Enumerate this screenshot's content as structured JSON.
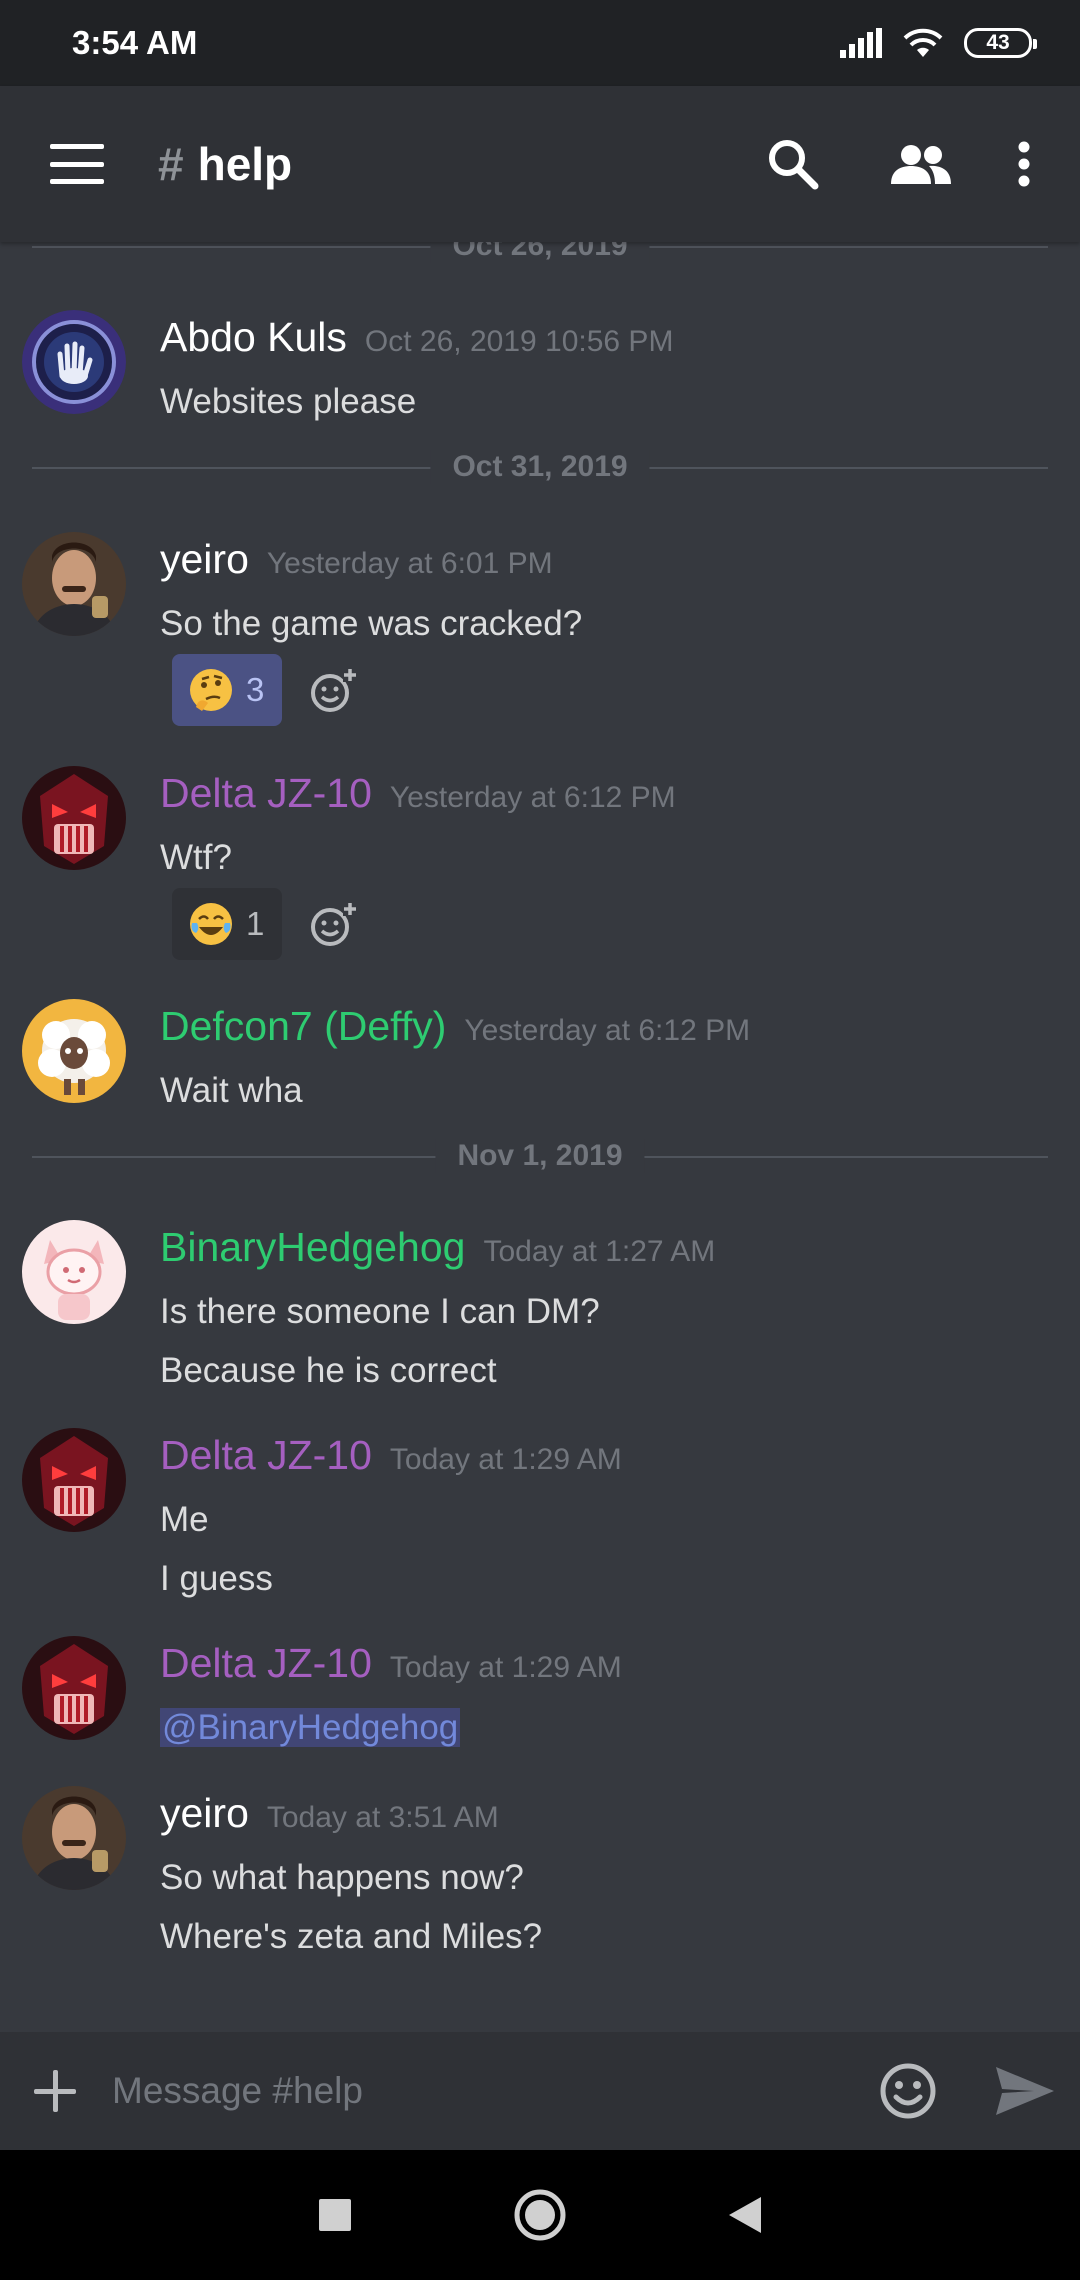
{
  "status_bar": {
    "time": "3:54 AM",
    "battery": "43"
  },
  "header": {
    "hash": "#",
    "channel": "help"
  },
  "dividers": [
    "Oct 26, 2019",
    "Oct 31, 2019",
    "Nov 1, 2019"
  ],
  "messages": [
    {
      "author": "Abdo Kuls",
      "color": "#ffffff",
      "timestamp": "Oct 26, 2019 10:56 PM",
      "lines": [
        "Websites please"
      ]
    },
    {
      "author": "yeiro",
      "color": "#ffffff",
      "timestamp": "Yesterday at 6:01 PM",
      "lines": [
        "So the game was cracked?"
      ],
      "reaction": {
        "emoji": "thinking-face",
        "count": "3"
      }
    },
    {
      "author": "Delta JZ-10",
      "color": "#a55fc0",
      "timestamp": "Yesterday at 6:12 PM",
      "lines": [
        "Wtf?"
      ],
      "reaction": {
        "emoji": "tears-of-joy",
        "count": "1"
      }
    },
    {
      "author": "Defcon7 (Deffy)",
      "color": "#2ecc71",
      "timestamp": "Yesterday at 6:12 PM",
      "lines": [
        "Wait wha"
      ]
    },
    {
      "author": "BinaryHedgehog",
      "color": "#2ecc71",
      "timestamp": "Today at 1:27 AM",
      "lines": [
        "Is there someone I can DM?",
        "Because he is correct"
      ]
    },
    {
      "author": "Delta JZ-10",
      "color": "#a55fc0",
      "timestamp": "Today at 1:29 AM",
      "lines": [
        "Me",
        "I guess"
      ]
    },
    {
      "author": "Delta JZ-10",
      "color": "#a55fc0",
      "timestamp": "Today at 1:29 AM",
      "lines": [
        "@BinaryHedgehog"
      ]
    },
    {
      "author": "yeiro",
      "color": "#ffffff",
      "timestamp": "Today at 3:51 AM",
      "lines": [
        "So what happens now?",
        "Where's zeta and Miles?"
      ]
    }
  ],
  "composer": {
    "placeholder": "Message #help"
  }
}
